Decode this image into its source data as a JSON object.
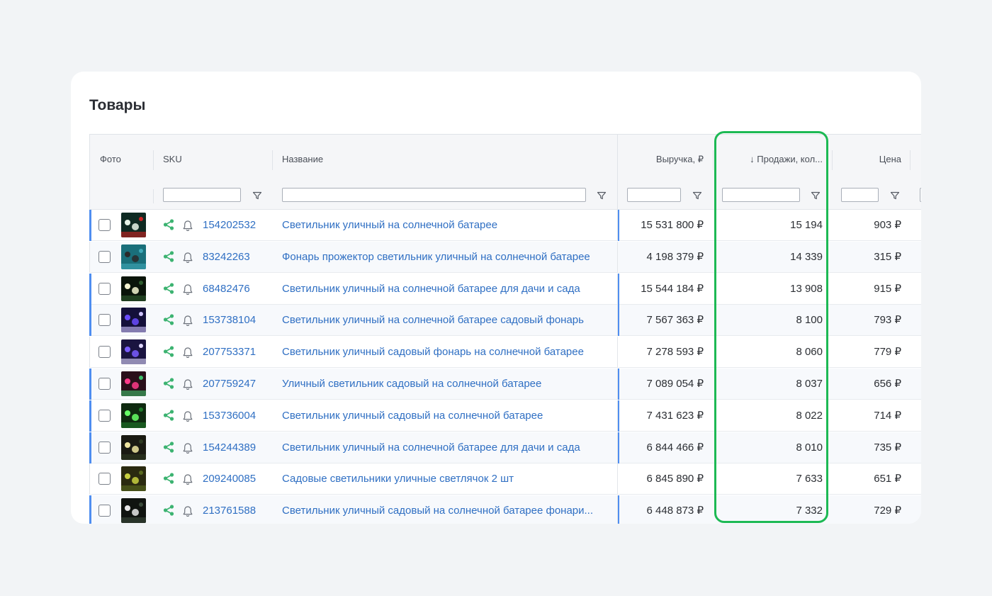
{
  "title": "Товары",
  "columns": {
    "photo": "Фото",
    "sku": "SKU",
    "name": "Название",
    "revenue": "Выручка, ₽",
    "sales": "↓ Продажи, кол...",
    "price": "Цена"
  },
  "icons": {
    "filter": "filter-icon",
    "share": "share-icon",
    "bell": "bell-icon",
    "checkbox": "checkbox"
  },
  "colors": {
    "link": "#2f6fc3",
    "share": "#3cb371",
    "marker": "#4f8ef0",
    "highlight": "#1db954"
  },
  "rows": [
    {
      "sku": "154202532",
      "name": "Светильник уличный на солнечной батарее",
      "revenue": "15 531 800 ₽",
      "sales": "15 194",
      "price": "903 ₽",
      "marked": true,
      "alt": false,
      "thumb": [
        "#0f2a22",
        "#e8f5e8",
        "#cc2222"
      ]
    },
    {
      "sku": "83242263",
      "name": "Фонарь прожектор светильник уличный на солнечной батарее",
      "revenue": "4 198 379 ₽",
      "sales": "14 339",
      "price": "315 ₽",
      "marked": false,
      "alt": true,
      "thumb": [
        "#1a6f7a",
        "#2a2a2a",
        "#3fa9b8"
      ]
    },
    {
      "sku": "68482476",
      "name": "Светильник уличный на солнечной батарее для дачи и сада",
      "revenue": "15 544 184 ₽",
      "sales": "13 908",
      "price": "915 ₽",
      "marked": true,
      "alt": false,
      "thumb": [
        "#0a140a",
        "#f4f4d0",
        "#2e5c2e"
      ]
    },
    {
      "sku": "153738104",
      "name": "Светильник уличный на солнечной батарее садовый фонарь",
      "revenue": "7 567 363 ₽",
      "sales": "8 100",
      "price": "793 ₽",
      "marked": true,
      "alt": true,
      "thumb": [
        "#14103a",
        "#6a4cff",
        "#cfc4ff"
      ]
    },
    {
      "sku": "207753371",
      "name": "Светильник уличный садовый фонарь на солнечной батарее",
      "revenue": "7 278 593 ₽",
      "sales": "8 060",
      "price": "779 ₽",
      "marked": false,
      "alt": false,
      "thumb": [
        "#1a1440",
        "#7a5cff",
        "#e0d8ff"
      ]
    },
    {
      "sku": "207759247",
      "name": "Уличный светильник садовый на солнечной батарее",
      "revenue": "7 089 054 ₽",
      "sales": "8 037",
      "price": "656 ₽",
      "marked": true,
      "alt": true,
      "thumb": [
        "#2a0f1a",
        "#ff3a8a",
        "#3fbf6a"
      ]
    },
    {
      "sku": "153736004",
      "name": "Светильник уличный садовый на солнечной батарее",
      "revenue": "7 431 623 ₽",
      "sales": "8 022",
      "price": "714 ₽",
      "marked": true,
      "alt": false,
      "thumb": [
        "#0f2a10",
        "#66ff66",
        "#1f7a2a"
      ]
    },
    {
      "sku": "154244389",
      "name": "Светильник уличный на солнечной батарее для дачи и сада",
      "revenue": "6 844 466 ₽",
      "sales": "8 010",
      "price": "735 ₽",
      "marked": true,
      "alt": true,
      "thumb": [
        "#1a1a12",
        "#f0e6a0",
        "#2e3a22"
      ]
    },
    {
      "sku": "209240085",
      "name": "Садовые светильники уличные светлячок 2 шт",
      "revenue": "6 845 890 ₽",
      "sales": "7 633",
      "price": "651 ₽",
      "marked": false,
      "alt": false,
      "thumb": [
        "#2a2a10",
        "#c8d040",
        "#5a6a20"
      ]
    },
    {
      "sku": "213761588",
      "name": "Светильник уличный садовый на солнечной батарее фонари...",
      "revenue": "6 448 873 ₽",
      "sales": "7 332",
      "price": "729 ₽",
      "marked": true,
      "alt": true,
      "thumb": [
        "#101410",
        "#e8e8e8",
        "#3a4a3a"
      ]
    }
  ]
}
